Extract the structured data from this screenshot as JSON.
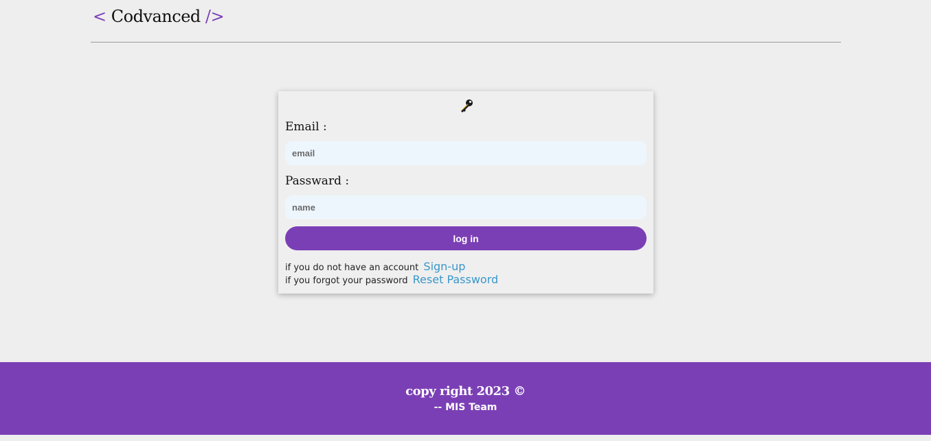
{
  "header": {
    "open_bracket": "<",
    "brand": "Codvanced",
    "close_bracket": "/>"
  },
  "login": {
    "icon": "key-icon",
    "email_label": "Email :",
    "email_placeholder": "email",
    "password_label": "Passward :",
    "password_placeholder": "name",
    "submit_label": "log in",
    "signup_prompt": "if you do not have an account",
    "signup_link": "Sign-up",
    "reset_prompt": "if you forgot your password",
    "reset_link": "Reset Password"
  },
  "footer": {
    "copyright": "copy right 2023 ©",
    "team": "-- MIS Team"
  },
  "colors": {
    "accent": "#7b3fb5",
    "link": "#3a97c9",
    "background": "#eeeeee",
    "input_bg": "#eef6fd"
  }
}
